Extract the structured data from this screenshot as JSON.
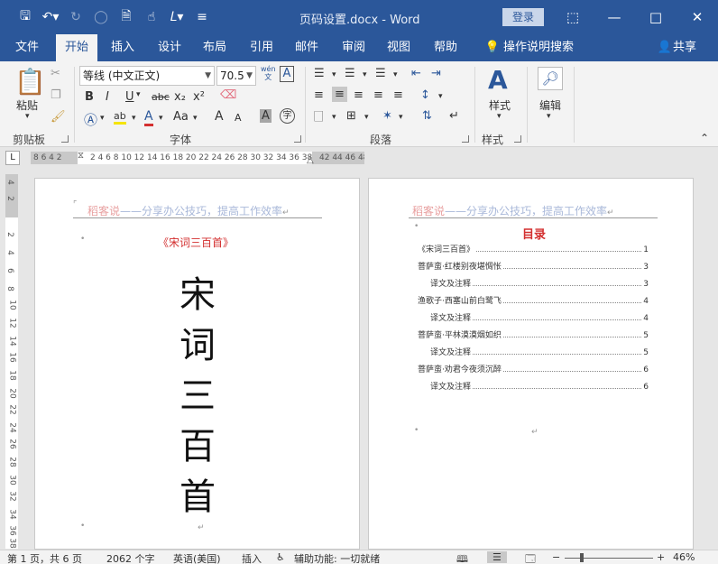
{
  "window": {
    "title": "页码设置.docx  -  Word",
    "login_label": "登录"
  },
  "tabs": [
    "文件",
    "开始",
    "插入",
    "设计",
    "布局",
    "引用",
    "邮件",
    "审阅",
    "视图",
    "帮助"
  ],
  "tell_me": "操作说明搜索",
  "share": "共享",
  "ribbon": {
    "paste_label": "粘贴",
    "font_name": "等线 (中文正文)",
    "font_size": "70.5",
    "styles_label": "样式",
    "edit_label": "编辑",
    "groups": {
      "clipboard": "剪贴板",
      "font": "字体",
      "paragraph": "段落",
      "styles": "样式"
    },
    "buttons": {
      "bold": "B",
      "italic": "I",
      "underline": "U",
      "strike": "abc",
      "subscript": "x₂",
      "superscript": "x²",
      "font_color": "A",
      "change_case": "Aa",
      "grow": "A",
      "shrink": "A",
      "char_shade": "A",
      "phonetic": "wén",
      "phonetic_char": "文",
      "enclose": "字"
    }
  },
  "ruler": {
    "corner": "L",
    "left_numbers": "8  6  4  2",
    "right_numbers": "2  4  6  8  10 12 14 16 18 20 22 24 26 28 30 32 34 36 38",
    "far_numbers": "42 44 46 48",
    "vertical": [
      "4",
      "2",
      "2",
      "4",
      "6",
      "8",
      "10",
      "12",
      "14",
      "16",
      "18",
      "20",
      "22",
      "24",
      "26",
      "28",
      "30",
      "32",
      "34",
      "36",
      "38"
    ]
  },
  "page1": {
    "header_main": "稻客说",
    "header_sub": "——分享办公技巧，提高工作效率",
    "title": "《宋词三百首》",
    "chars": [
      "宋",
      "词",
      "三",
      "百",
      "首"
    ]
  },
  "page2": {
    "header_main": "稻客说",
    "header_sub": "——分享办公技巧，提高工作效率",
    "toc_title": "目录",
    "toc": [
      {
        "text": "《宋词三百首》",
        "page": "1",
        "level": 1
      },
      {
        "text": "菩萨蛮·红楼别夜堪惆怅",
        "page": "3",
        "level": 1
      },
      {
        "text": "译文及注释",
        "page": "3",
        "level": 2
      },
      {
        "text": "渔歌子·西塞山前白鹭飞",
        "page": "4",
        "level": 1
      },
      {
        "text": "译文及注释",
        "page": "4",
        "level": 2
      },
      {
        "text": "菩萨蛮·平林漠漠烟如织",
        "page": "5",
        "level": 1
      },
      {
        "text": "译文及注释",
        "page": "5",
        "level": 2
      },
      {
        "text": "菩萨蛮·劝君今夜须沉醉",
        "page": "6",
        "level": 1
      },
      {
        "text": "译文及注释",
        "page": "6",
        "level": 2
      }
    ]
  },
  "status": {
    "page": "第 1 页，共 6 页",
    "words": "2062 个字",
    "language": "英语(美国)",
    "mode": "插入",
    "accessibility": "辅助功能: 一切就绪",
    "zoom": "46%",
    "zoom_minus": "−",
    "zoom_plus": "+"
  },
  "colors": {
    "brand": "#2b579a",
    "toc_title": "#d32f2f",
    "header_red": "#e8a0a0",
    "header_blue": "#a9b8d9"
  }
}
